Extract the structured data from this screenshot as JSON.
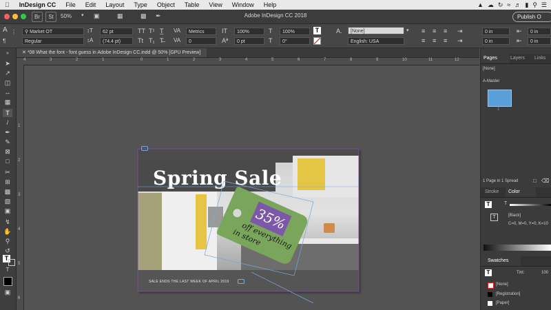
{
  "menubar": {
    "app_name": "InDesign CC",
    "items": [
      "File",
      "Edit",
      "Layout",
      "Type",
      "Object",
      "Table",
      "View",
      "Window",
      "Help"
    ]
  },
  "appbar": {
    "zoom": "50%",
    "title": "Adobe InDesign CC 2018",
    "publish": "Publish O",
    "br_label": "Br",
    "st_label": "St"
  },
  "control": {
    "font_family": "Market OT",
    "font_style": "Regular",
    "font_size": "62 pt",
    "leading": "(74.4 pt)",
    "kerning": "Metrics",
    "tracking": "0",
    "hscale": "100%",
    "vscale": "100%",
    "baseline": "0 pt",
    "skew": "0°",
    "char_style": "[None]",
    "language": "English: USA",
    "indent1": "0 in",
    "indent2": "0 in",
    "indent3": "0 in",
    "indent4": "0 in"
  },
  "document": {
    "tab_label": "*08 What the font - font guess in Adobe InDesign CC.indd @ 50% [GPU Preview]",
    "headline": "Spring Sale",
    "tag_percent": "35%",
    "tag_line1": "off everything",
    "tag_line2": "in store",
    "footer": "SALE ENDS THE LAST WEEK OF APRIL 2019"
  },
  "ruler": {
    "top": [
      "4",
      "3",
      "2",
      "1",
      "0",
      "1",
      "2",
      "3",
      "4",
      "5",
      "6",
      "7",
      "8",
      "9",
      "10",
      "11",
      "12"
    ],
    "left": [
      "1",
      "2",
      "3",
      "4",
      "5",
      "6"
    ]
  },
  "pages_panel": {
    "tabs": [
      "Pages",
      "Layers",
      "Links"
    ],
    "none": "[None]",
    "master": "A-Master",
    "page_num": "1",
    "status": "1 Page in 1 Spread"
  },
  "color_panel": {
    "tabs": [
      "Stroke",
      "Color"
    ],
    "swatch": "[Black]",
    "cmyk": "C=0, M=0, Y=0, K=10"
  },
  "swatches_panel": {
    "title": "Swatches",
    "tint_label": "Tint:",
    "tint": "100",
    "items": [
      "[None]",
      "[Registration]",
      "[Paper]"
    ]
  }
}
